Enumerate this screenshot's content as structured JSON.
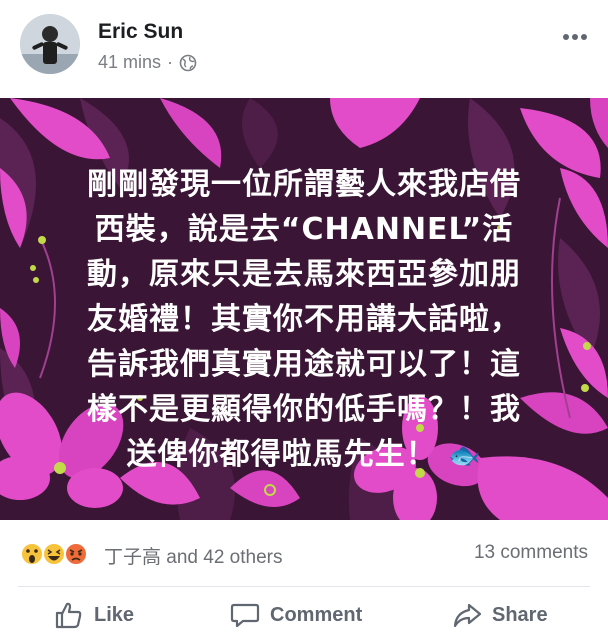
{
  "post": {
    "author": "Eric Sun",
    "time": "41 mins",
    "separator": "·",
    "text_lines": [
      "剛剛發現一位所謂藝人來我店借",
      "西裝，說是去“CHANNEL”活",
      "動，原來只是去馬來西亞參加朋",
      "友婚禮！其實你不用講大話啦，",
      "告訴我們真實用途就可以了！這",
      "樣不是更顯得你的低手嗎？！我",
      "送俾你都得啦馬先生！"
    ],
    "fish_emoji": "🐟"
  },
  "reactions": {
    "icons": [
      "wow-icon",
      "haha-icon",
      "angry-icon"
    ],
    "names": "丁子高 and 42 others",
    "comments": "13 comments"
  },
  "actions": {
    "like": "Like",
    "comment": "Comment",
    "share": "Share"
  },
  "colors": {
    "image_bg": "#3a1535",
    "petal_pink": "#e24cc8",
    "leaf_purple": "#6a2a63",
    "text_gray": "#6b6e73"
  }
}
